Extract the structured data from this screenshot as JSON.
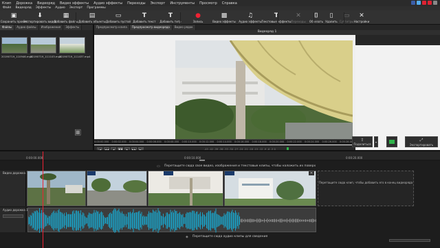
{
  "menu": [
    "Клип",
    "Дорожка",
    "Видеоряд",
    "Видео эффекты",
    "Аудио эффекты",
    "Переходы",
    "Экспорт",
    "Инструменты",
    "Просмотр",
    "Справка"
  ],
  "subbar": [
    "Файл",
    "Видеоряд",
    "Эффекты",
    "Аудио",
    "Экспорт",
    "Программы"
  ],
  "toolbar": [
    {
      "label": "Сохранить проект",
      "icon": "save-icon",
      "glyph": "▣",
      "enabled": true
    },
    {
      "label": "Экспортировать видео",
      "icon": "export-icon",
      "glyph": "⬇",
      "enabled": true
    },
    {
      "label": "Добавить файлы",
      "icon": "add-files-icon",
      "glyph": "▦",
      "enabled": true
    },
    {
      "label": "Добавить объекты",
      "icon": "add-objects-icon",
      "glyph": "▤",
      "enabled": true
    },
    {
      "label": "Добавить пустой",
      "icon": "add-blank-icon",
      "glyph": "▭",
      "enabled": true
    },
    {
      "label": "Добавить текст",
      "icon": "add-text-icon",
      "glyph": "T",
      "enabled": true
    },
    {
      "label": "Добавить титр",
      "icon": "add-title-icon",
      "glyph": "T",
      "enabled": true
    },
    {
      "label": "Запись",
      "icon": "record-icon",
      "glyph": "●",
      "enabled": true
    },
    {
      "label": "Видео эффекты",
      "icon": "video-effects-icon",
      "glyph": "▩",
      "enabled": true
    },
    {
      "label": "Аудио эффекты",
      "icon": "audio-effects-icon",
      "glyph": "♫",
      "enabled": true
    },
    {
      "label": "Текстовые эффекты",
      "icon": "text-effects-icon",
      "glyph": "T",
      "enabled": true
    },
    {
      "label": "Переходы",
      "icon": "transitions-icon",
      "glyph": "✕",
      "enabled": false
    },
    {
      "label": "Обрезать",
      "icon": "crop-icon",
      "glyph": "⌷",
      "enabled": true
    },
    {
      "label": "Удалить",
      "icon": "delete-icon",
      "glyph": "▯",
      "enabled": true
    },
    {
      "label": "Субтитры",
      "icon": "subtitles-icon",
      "glyph": "▭",
      "enabled": false
    },
    {
      "label": "Настройки",
      "icon": "settings-icon",
      "glyph": "✕",
      "enabled": true
    }
  ],
  "left_tabs": [
    "Файлы",
    "Аудио файлы",
    "Изображения",
    "Эффекты"
  ],
  "files": [
    "20190719_110946.mp4",
    "20190719_111103.mp4",
    "20190719_111437.mp4"
  ],
  "preview_tabs": [
    "Предпросмотр клипа",
    "Предпросмотр видеоряда",
    "Видео рядок"
  ],
  "preview_title": "Видеоряд 1",
  "ruler_ticks": [
    "0:00:00.000",
    "0:00:02.000",
    "0:00:04.000",
    "0:00:06.000",
    "0:00:08.000",
    "0:00:10.000",
    "0:00:12.000",
    "0:00:14.000",
    "0:00:16.000",
    "0:00:18.000",
    "0:00:20.000",
    "0:00:22.000",
    "0:00:24.000",
    "0:00:26.000",
    "0:00:28.000"
  ],
  "meter_scale": "-45 -42 -39 -36 -33 -30 -27 -24 -21 -18 -15 -12 -9 -6 -3 0",
  "tooltip": "Пауза (Space)",
  "export_buttons": [
    "Поделиться",
    "",
    "Экспортировать"
  ],
  "timeline": {
    "marks": [
      "0:00:00.000",
      "0:00:10.000",
      "0:00:20.000"
    ],
    "video_hint": "Перетащите сюда свое видео, изображения и текстовые клипы, чтобы наложить их поверх",
    "video_track": "Видео дорожка 1",
    "audio_track": "Аудио дорожка 1",
    "dropzone": "Перетащите сюда клип, чтобы добавить его в конец видеоряда",
    "audio_hint": "Перетащите сюда аудио клипы для сведения"
  },
  "colors": {
    "accent": "#3a7bd5",
    "waveform": "#1aa3c9",
    "playhead": "#e23333"
  }
}
